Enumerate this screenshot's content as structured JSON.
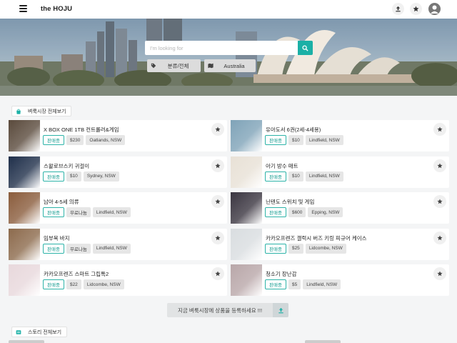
{
  "header": {
    "brand": "the HOJU",
    "icons": [
      "upload-icon",
      "star-icon",
      "user-avatar"
    ]
  },
  "hero": {
    "search_placeholder": "I'm looking for",
    "filters": [
      {
        "icon": "tag-icon",
        "label": "분류/전체"
      },
      {
        "icon": "map-icon",
        "label": "Australia"
      }
    ]
  },
  "market": {
    "section_label": "벼룩시장 전체보기",
    "items": [
      {
        "title": "X BOX ONE 1TB 컨트롤러&게임",
        "status": "판매중",
        "price": "$230",
        "location": "Oatlands, NSW",
        "thumb_color": "#5a4a3c"
      },
      {
        "title": "유아도서 6권(2세-4세용)",
        "status": "판매중",
        "price": "$10",
        "location": "Lindfield, NSW",
        "thumb_color": "#7fa3b8"
      },
      {
        "title": "스왈로브스키 귀걸이",
        "status": "판매중",
        "price": "$10",
        "location": "Sydney, NSW",
        "thumb_color": "#1f2f4a"
      },
      {
        "title": "아기 방수 매트",
        "status": "판매중",
        "price": "$10",
        "location": "Lindfield, NSW",
        "thumb_color": "#e8e1d6"
      },
      {
        "title": "남아 4-5세 의류",
        "status": "판매중",
        "price": "무료나눔",
        "location": "Lindfield, NSW",
        "thumb_color": "#8a5c3c"
      },
      {
        "title": "닌텐도 스위치 및 게임",
        "status": "판매중",
        "price": "$600",
        "location": "Epping, NSW",
        "thumb_color": "#3a3540"
      },
      {
        "title": "임부복 바지",
        "status": "판매중",
        "price": "무료나눔",
        "location": "Lindfield, NSW",
        "thumb_color": "#8c6a4c"
      },
      {
        "title": "카카오프렌즈 갤럭시 버즈 키링 피규어 케이스",
        "status": "판매중",
        "price": "$25",
        "location": "Lidcombe, NSW",
        "thumb_color": "#d9dde0"
      },
      {
        "title": "카카오프렌즈 스마트 그립톡2",
        "status": "판매중",
        "price": "$22",
        "location": "Lidcombe, NSW",
        "thumb_color": "#e8d8dc"
      },
      {
        "title": "청소기 장난감",
        "status": "판매중",
        "price": "$5",
        "location": "Lindfield, NSW",
        "thumb_color": "#b9a7a9"
      }
    ]
  },
  "cta": {
    "label": "지금 벼룩시장에 상품을 등록하세요 !!!"
  },
  "story": {
    "section_label": "스토리 전체보기"
  },
  "colors": {
    "accent": "#1bb0a6",
    "status_border": "#2cb3a8"
  }
}
